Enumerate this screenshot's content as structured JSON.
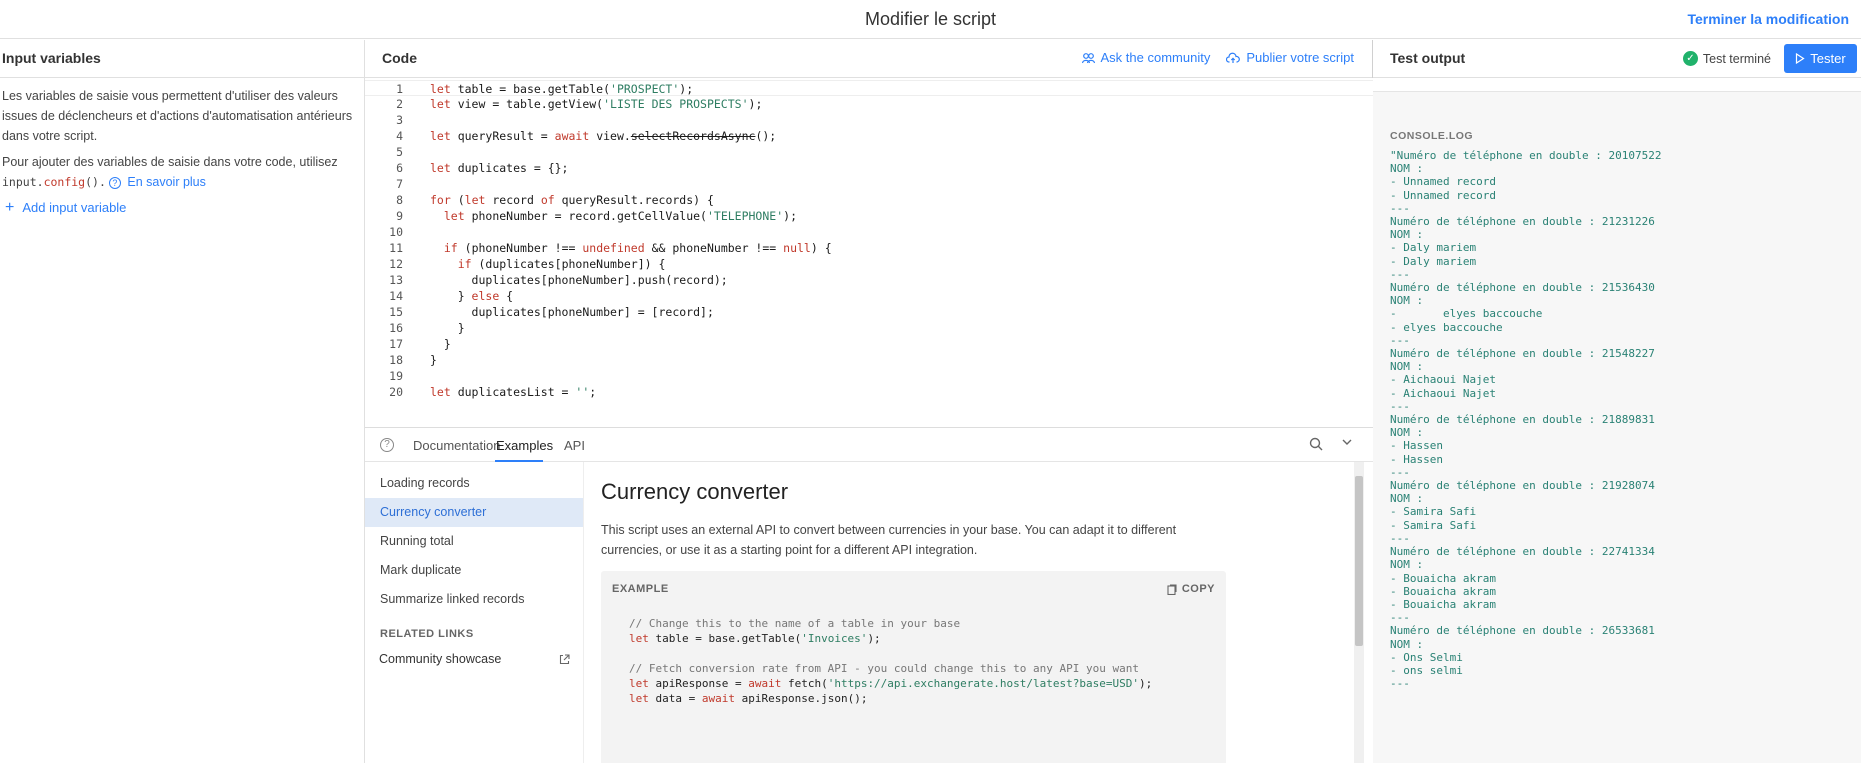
{
  "header": {
    "title": "Modifier le script",
    "finish_label": "Terminer la modification"
  },
  "input_panel": {
    "title": "Input variables",
    "para1": "Les variables de saisie vous permettent d'utiliser des valeurs issues de déclencheurs et d'actions d'automatisation antérieurs dans votre script.",
    "para2_prefix": "Pour ajouter des variables de saisie dans votre code, utilisez",
    "code_obj": "input",
    "code_dot": ".",
    "code_fn": "config",
    "code_tail": "().",
    "learn_more": "En savoir plus",
    "add_label": "Add input variable"
  },
  "code_panel": {
    "title": "Code",
    "ask_community": "Ask the community",
    "publish": "Publier votre script"
  },
  "docs": {
    "tabs": [
      "Documentation",
      "Examples",
      "API"
    ],
    "nav_items": [
      "Loading records",
      "Currency converter",
      "Running total",
      "Mark duplicate",
      "Summarize linked records"
    ],
    "active_nav": "Currency converter",
    "related_title": "RELATED LINKS",
    "community_link": "Community showcase",
    "heading": "Currency converter",
    "description": "This script uses an external API to convert between currencies in your base. You can adapt it to different currencies, or use it as a starting point for a different API integration.",
    "example_label": "EXAMPLE",
    "copy_label": "COPY"
  },
  "test_panel": {
    "title": "Test output",
    "status": "Test terminé",
    "run_label": "Tester",
    "console_label": "CONSOLE.LOG",
    "console_lines": [
      "\"Numéro de téléphone en double : 20107522",
      "NOM :",
      "- Unnamed record",
      "- Unnamed record",
      "---",
      "Numéro de téléphone en double : 21231226",
      "NOM :",
      "- Daly mariem",
      "- Daly mariem",
      "---",
      "Numéro de téléphone en double : 21536430",
      "NOM :",
      "-       elyes baccouche",
      "- elyes baccouche",
      "---",
      "Numéro de téléphone en double : 21548227",
      "NOM :",
      "- Aichaoui Najet",
      "- Aichaoui Najet",
      "---",
      "Numéro de téléphone en double : 21889831",
      "NOM :",
      "- Hassen",
      "- Hassen",
      "---",
      "Numéro de téléphone en double : 21928074",
      "NOM :",
      "- Samira Safi",
      "- Samira Safi",
      "---",
      "Numéro de téléphone en double : 22741334",
      "NOM :",
      "- Bouaicha akram",
      "- Bouaicha akram",
      "- Bouaicha akram",
      "---",
      "Numéro de téléphone en double : 26533681",
      "NOM :",
      "- Ons Selmi",
      "- ons selmi",
      "---"
    ]
  },
  "editor": {
    "line_numbers": [
      "1",
      "2",
      "3",
      "4",
      "5",
      "6",
      "7",
      "8",
      "9",
      "10",
      "11",
      "12",
      "13",
      "14",
      "15",
      "16",
      "17",
      "18",
      "19",
      "20"
    ]
  },
  "colors": {
    "accent": "#2d7ff9",
    "keyword": "#c0392b",
    "string": "#2e7d62",
    "console_text": "#2a8275",
    "success": "#20b26b"
  }
}
